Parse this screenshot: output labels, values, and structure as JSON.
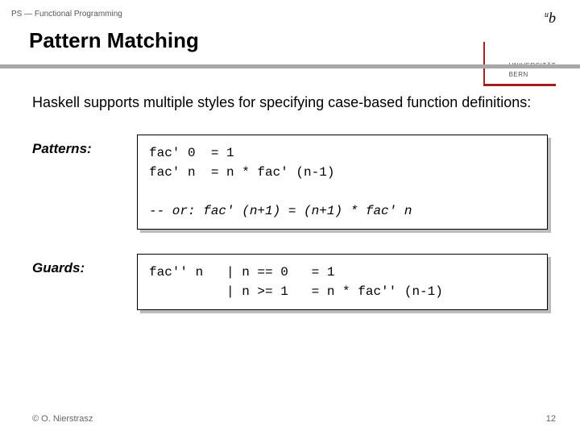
{
  "header": {
    "course": "PS — Functional Programming"
  },
  "title": "Pattern Matching",
  "university": {
    "symbol_sup": "u",
    "symbol_main": "b",
    "line1": "UNIVERSITÄT",
    "line2": "BERN"
  },
  "intro": "Haskell supports multiple styles for specifying case-based function definitions:",
  "patterns": {
    "label": "Patterns:",
    "code_line1": "fac' 0  = 1",
    "code_line2": "fac' n  = n * fac' (n-1)",
    "code_blank": "",
    "code_comment": "-- or: fac' (n+1) = (n+1) * fac' n"
  },
  "guards": {
    "label": "Guards:",
    "code_line1": "fac'' n   | n == 0   = 1",
    "code_line2": "          | n >= 1   = n * fac'' (n-1)"
  },
  "footer": {
    "copyright": "© O. Nierstrasz",
    "page": "12"
  }
}
